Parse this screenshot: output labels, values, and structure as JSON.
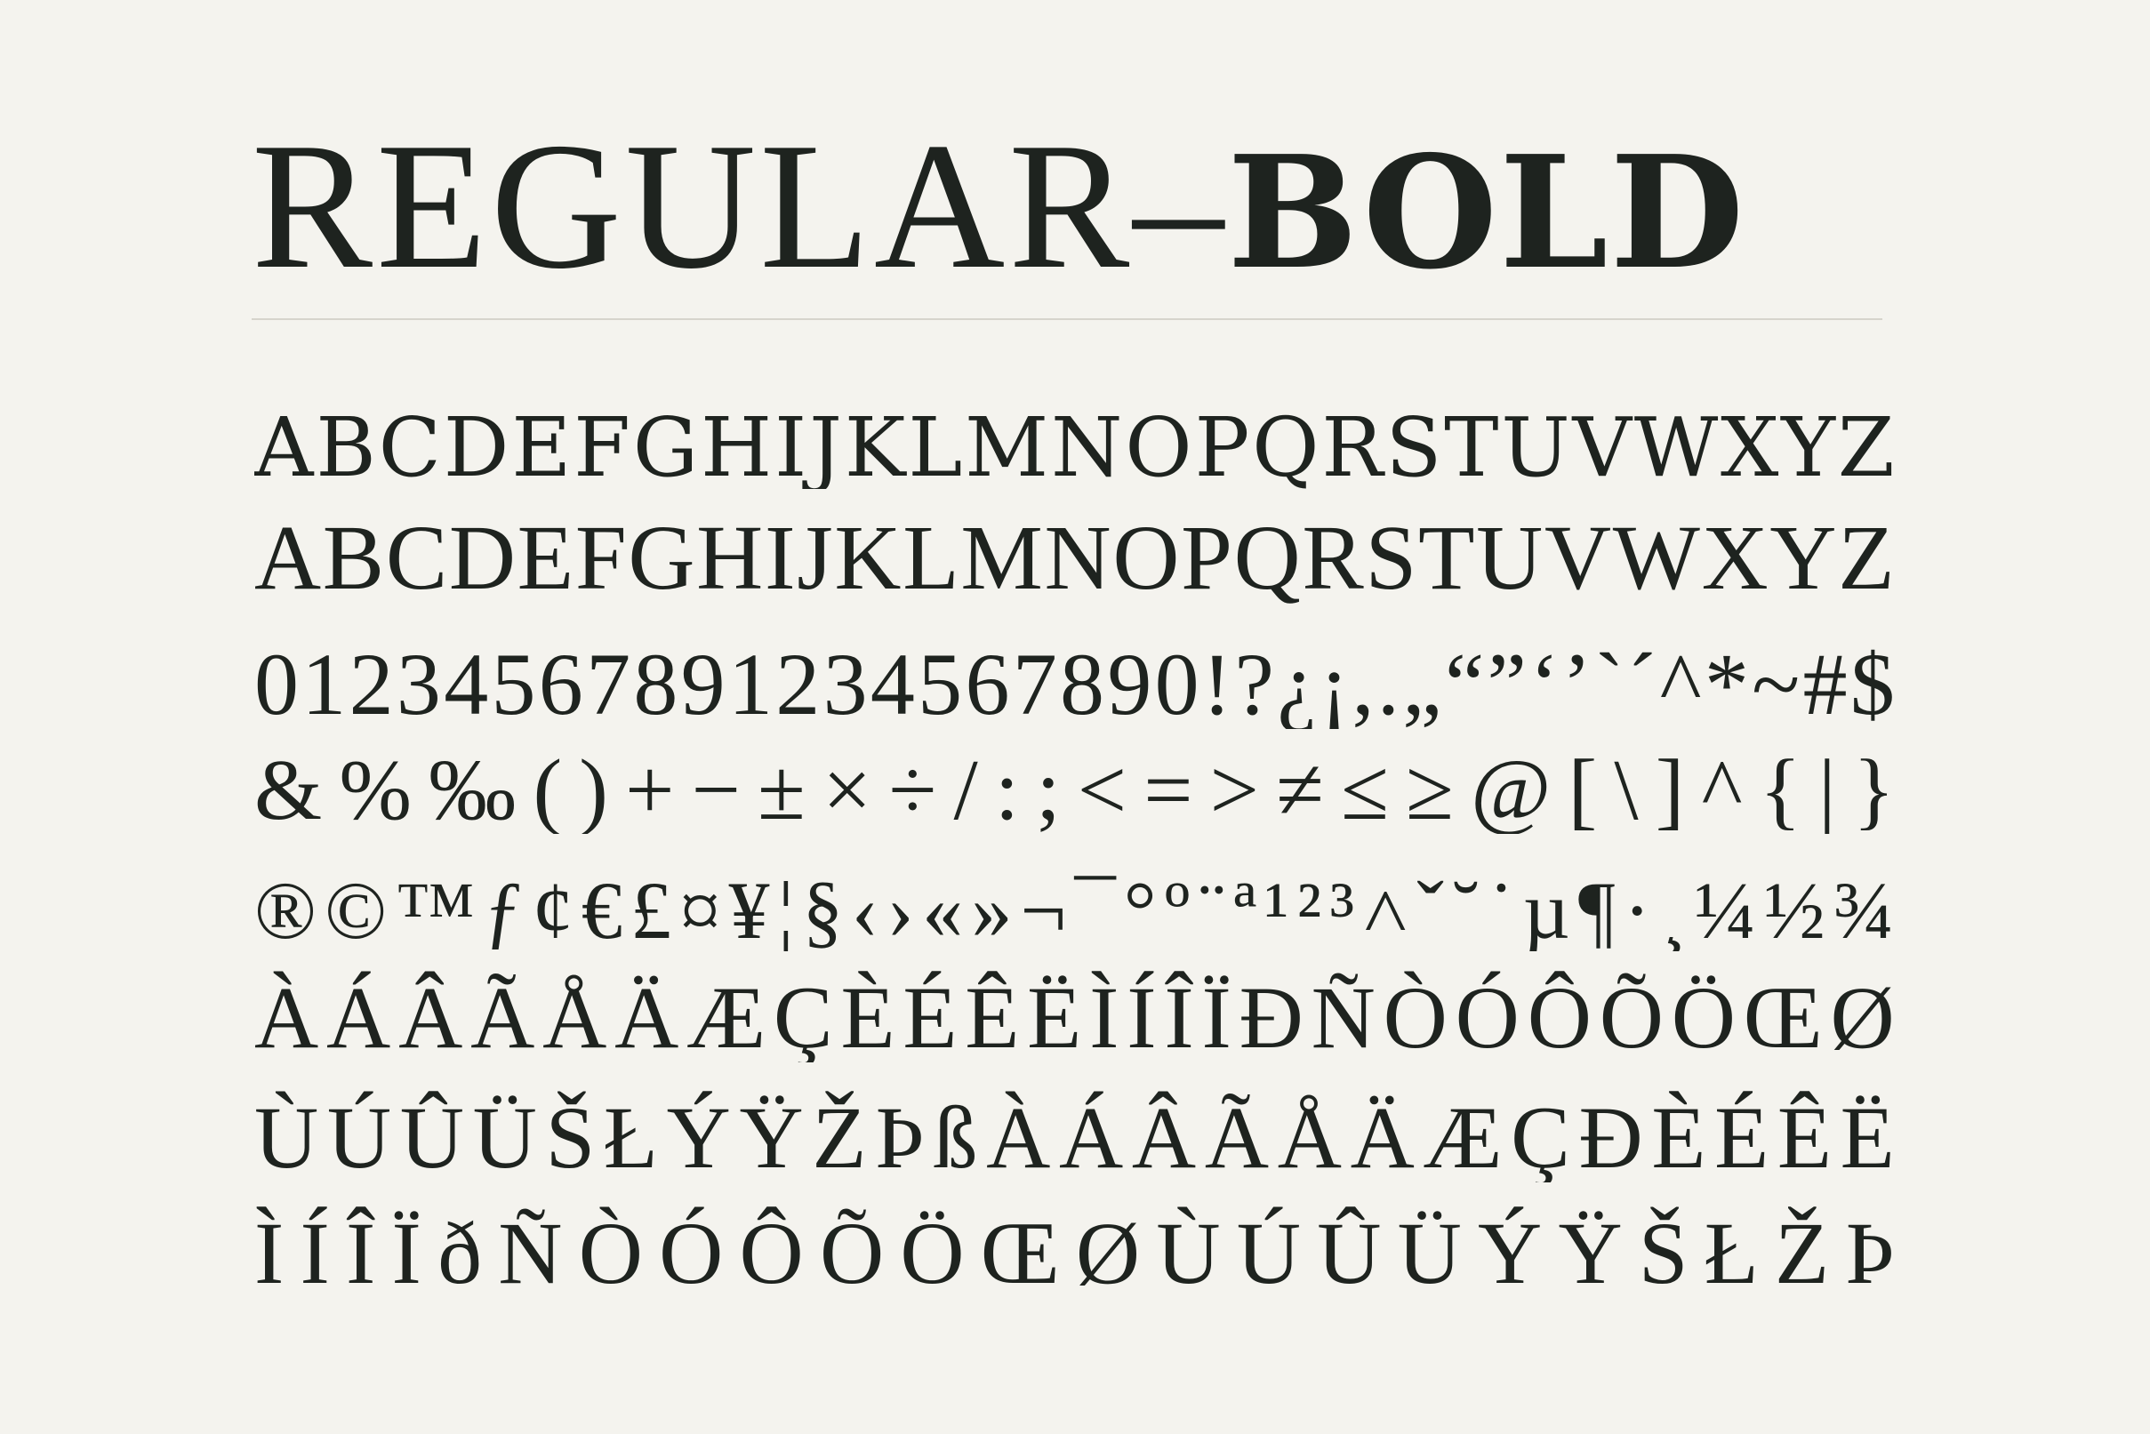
{
  "title": {
    "regular": "REGULAR–",
    "bold": "BOLD"
  },
  "rows": [
    "ABCDEFGHIJKLMNOPQRSTUVWXYZ",
    "ABCDEFGHIJKLMNOPQRSTUVWXYZ",
    "01234567891234567890!?¿¡,.„“”‘’`´^*~#$",
    "&%‰()+−±×÷/:;<=>≠≤≥@[\\]^{|}",
    "®©™ƒ¢€£¤¥¦§‹›«»¬¯°º¨ª¹²³˄ˇ˘˙µ¶·¸¼½¾",
    "ÀÁÂÃÅÄÆÇÈÉÊËÌÍÎÏÐÑÒÓÔÕÖŒØ",
    "ÙÚÛÜŠŁÝŸŽÞßÀÁÂÃÅÄÆÇĐÈÉÊË",
    "ÌÍÎÏðÑÒÓÔÕÖŒØÙÚÛÜÝŸŠŁŽÞ"
  ]
}
